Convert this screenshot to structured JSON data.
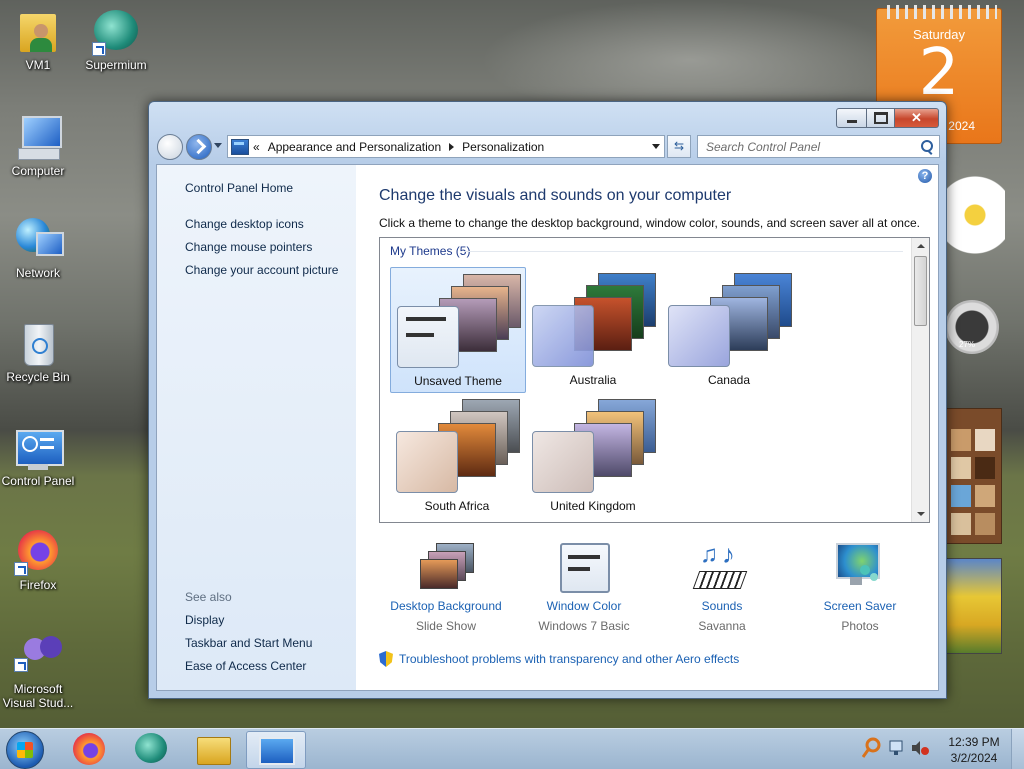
{
  "desktop": {
    "icons": [
      {
        "label": "VM1",
        "icon": "user-folder-icon"
      },
      {
        "label": "Supermium",
        "icon": "supermium-icon"
      },
      {
        "label": "Computer",
        "icon": "computer-icon"
      },
      {
        "label": "Network",
        "icon": "network-icon"
      },
      {
        "label": "Recycle Bin",
        "icon": "recycle-bin-icon"
      },
      {
        "label": "Control Panel",
        "icon": "control-panel-icon"
      },
      {
        "label": "Firefox",
        "icon": "firefox-icon"
      },
      {
        "label": "Microsoft Visual Stud...",
        "icon": "visual-studio-icon"
      }
    ]
  },
  "gadgets": {
    "calendar": {
      "weekday": "Saturday",
      "day": "2",
      "year": "2024"
    },
    "cpu_meter": {
      "value": "27%"
    }
  },
  "window": {
    "address": {
      "root_chevron": "«",
      "crumbs": [
        "Appearance and Personalization",
        "Personalization"
      ]
    },
    "search_placeholder": "Search Control Panel",
    "left_nav": {
      "home": "Control Panel Home",
      "links": [
        "Change desktop icons",
        "Change mouse pointers",
        "Change your account picture"
      ],
      "see_also_label": "See also",
      "see_also": [
        "Display",
        "Taskbar and Start Menu",
        "Ease of Access Center"
      ]
    },
    "main": {
      "help": "?",
      "title": "Change the visuals and sounds on your computer",
      "subtitle": "Click a theme to change the desktop background, window color, sounds, and screen saver all at once.",
      "group_label": "My Themes (5)",
      "themes": [
        "Unsaved Theme",
        "Australia",
        "Canada",
        "South Africa",
        "United Kingdom"
      ],
      "selected_theme": "Unsaved Theme",
      "settings": [
        {
          "name": "Desktop Background",
          "value": "Slide Show"
        },
        {
          "name": "Window Color",
          "value": "Windows 7 Basic"
        },
        {
          "name": "Sounds",
          "value": "Savanna"
        },
        {
          "name": "Screen Saver",
          "value": "Photos"
        }
      ],
      "troubleshoot": "Troubleshoot problems with transparency and other Aero effects"
    }
  },
  "taskbar": {
    "clock_time": "12:39 PM",
    "clock_date": "3/2/2024"
  },
  "colors": {
    "link": "#1b61b3",
    "heading": "#1e3a6e",
    "close": "#c7472c"
  }
}
